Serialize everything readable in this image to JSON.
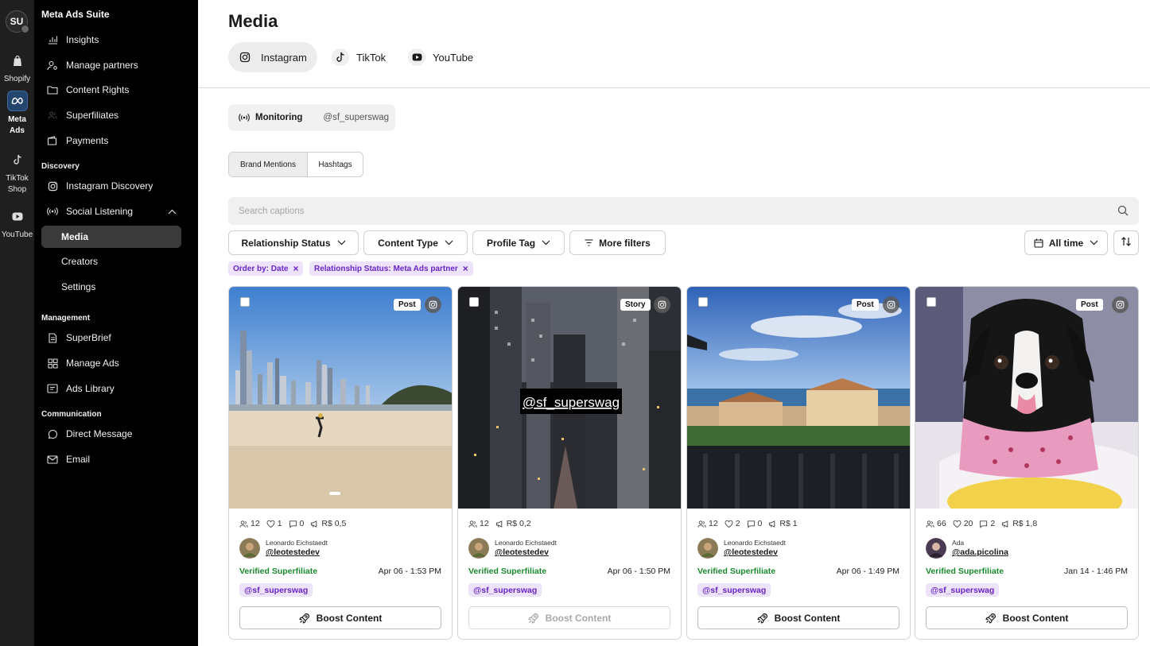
{
  "rail": {
    "avatar": "SU",
    "apps": [
      {
        "label": "Shopify",
        "icon": "shopify-icon"
      },
      {
        "label": "Meta Ads",
        "icon": "meta-icon"
      },
      {
        "label": "TikTok Shop",
        "icon": "tiktok-icon"
      },
      {
        "label": "YouTube",
        "icon": "youtube-icon"
      }
    ]
  },
  "sidebar": {
    "brand": "Meta Ads Suite",
    "items": [
      {
        "label": "Insights"
      },
      {
        "label": "Manage partners"
      },
      {
        "label": "Content Rights"
      },
      {
        "label": "Superfiliates"
      },
      {
        "label": "Payments"
      }
    ],
    "discovery": {
      "title": "Discovery",
      "instagram": "Instagram Discovery",
      "social": "Social Listening",
      "media": "Media",
      "creators": "Creators",
      "settings": "Settings"
    },
    "management": {
      "title": "Management",
      "superbrief": "SuperBrief",
      "manage_ads": "Manage Ads",
      "ads_library": "Ads Library"
    },
    "communication": {
      "title": "Communication",
      "dm": "Direct Message",
      "email": "Email"
    }
  },
  "main": {
    "title": "Media",
    "platform_tabs": [
      {
        "label": "Instagram",
        "active": true
      },
      {
        "label": "TikTok"
      },
      {
        "label": "YouTube"
      }
    ],
    "monitoring": {
      "label": "Monitoring",
      "handle": "@sf_superswag"
    },
    "segments": [
      "Brand Mentions",
      "Hashtags"
    ],
    "search": {
      "placeholder": "Search captions"
    },
    "filters": [
      "Relationship Status",
      "Content Type",
      "Profile Tag",
      "More filters"
    ],
    "time": "All time",
    "chips": [
      "Order by: Date",
      "Relationship Status: Meta Ads partner"
    ]
  },
  "cards": [
    {
      "type": "Post",
      "followers": "12",
      "likes": "1",
      "comments": "0",
      "value": "R$ 0,5",
      "name": "Leonardo Eichstaedt",
      "handle": "@leotestedev",
      "status": "Verified Superfiliate",
      "date": "Apr 06 - 1:53 PM",
      "tag": "@sf_superswag",
      "boost": "Boost Content",
      "boost_enabled": true
    },
    {
      "type": "Story",
      "followers": "12",
      "value": "R$ 0,2",
      "overlay": "@sf_superswag",
      "name": "Leonardo Eichstaedt",
      "handle": "@leotestedev",
      "status": "Verified Superfiliate",
      "date": "Apr 06 - 1:50 PM",
      "tag": "@sf_superswag",
      "boost": "Boost Content",
      "boost_enabled": false
    },
    {
      "type": "Post",
      "followers": "12",
      "likes": "2",
      "comments": "0",
      "value": "R$ 1",
      "name": "Leonardo Eichstaedt",
      "handle": "@leotestedev",
      "status": "Verified Superfiliate",
      "date": "Apr 06 - 1:49 PM",
      "tag": "@sf_superswag",
      "boost": "Boost Content",
      "boost_enabled": true
    },
    {
      "type": "Post",
      "followers": "66",
      "likes": "20",
      "comments": "2",
      "value": "R$ 1,8",
      "name": "Ada",
      "handle": "@ada.picolina",
      "status": "Verified Superfiliate",
      "date": "Jan 14 - 1:46 PM",
      "tag": "@sf_superswag",
      "boost": "Boost Content",
      "boost_enabled": true
    }
  ]
}
